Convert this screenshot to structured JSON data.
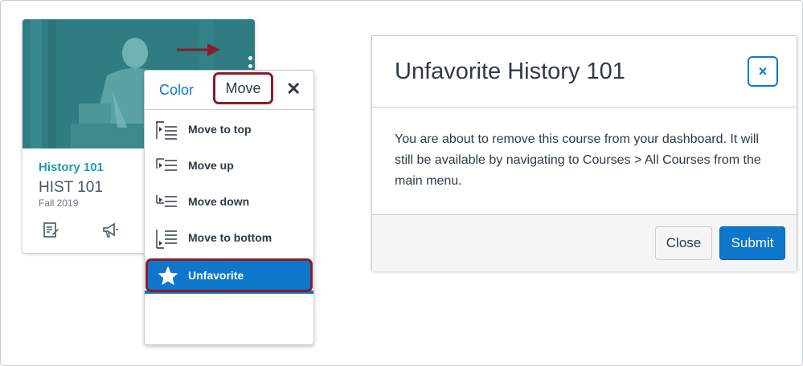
{
  "card": {
    "title": "History 101",
    "code": "HIST 101",
    "term": "Fall 2019",
    "icons": [
      "assignments-icon",
      "announcements-icon"
    ]
  },
  "menu": {
    "tabs": {
      "color": "Color",
      "move": "Move",
      "close": "✕"
    },
    "items": [
      {
        "label": "Move to top",
        "icon": "move-to-top-icon"
      },
      {
        "label": "Move up",
        "icon": "move-up-icon"
      },
      {
        "label": "Move down",
        "icon": "move-down-icon"
      },
      {
        "label": "Move to bottom",
        "icon": "move-to-bottom-icon"
      },
      {
        "label": "Unfavorite",
        "icon": "star-icon"
      }
    ]
  },
  "dialog": {
    "title": "Unfavorite History 101",
    "close_glyph": "×",
    "body": "You are about to remove this course from your dashboard. It will still be available by navigating to Courses > All Courses from the main menu.",
    "buttons": {
      "close": "Close",
      "submit": "Submit"
    }
  },
  "colors": {
    "accent": "#0e77cb",
    "highlight_outline": "#8b1b2b",
    "card_hero": "#2f7b80",
    "course_link": "#1f9bb1"
  }
}
